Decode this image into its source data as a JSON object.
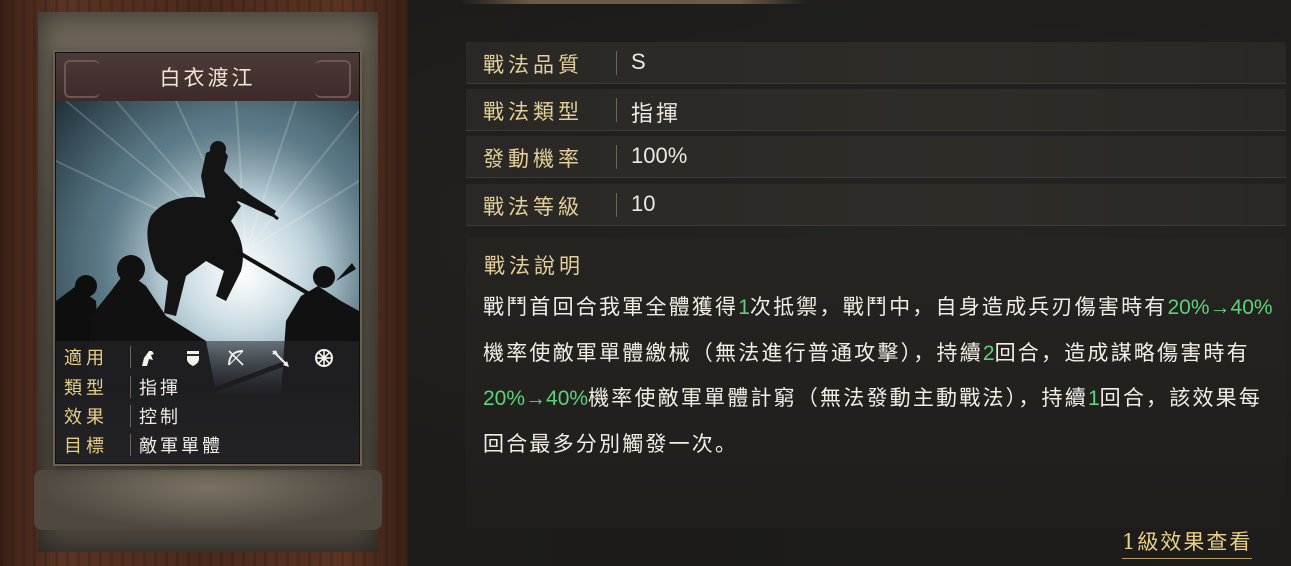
{
  "card": {
    "title": "白衣渡江",
    "stats": [
      {
        "key": "適用",
        "value": ""
      },
      {
        "key": "類型",
        "value": "指揮"
      },
      {
        "key": "效果",
        "value": "控制"
      },
      {
        "key": "目標",
        "value": "敵軍單體"
      }
    ],
    "troop_icons": [
      "cavalry-icon",
      "shield-icon",
      "bow-icon",
      "spear-icon",
      "chariot-wheel-icon"
    ]
  },
  "info": {
    "rows": [
      {
        "key": "戰法品質",
        "value": "S"
      },
      {
        "key": "戰法類型",
        "value": "指揮"
      },
      {
        "key": "發動機率",
        "value": "100%"
      },
      {
        "key": "戰法等級",
        "value": "10"
      }
    ],
    "desc_title": "戰法說明",
    "desc": [
      {
        "t": "戰鬥首回合我軍全體獲得",
        "h": false
      },
      {
        "t": "1",
        "h": true
      },
      {
        "t": "次抵禦，戰鬥中，自身造成兵刃傷害時有",
        "h": false
      },
      {
        "t": "20%→40%",
        "h": true
      },
      {
        "t": "機率使敵軍單體繳械（無法進行普通攻擊），持續",
        "h": false
      },
      {
        "t": "2",
        "h": true
      },
      {
        "t": "回合，造成謀略傷害時有",
        "h": false
      },
      {
        "t": "20%→40%",
        "h": true
      },
      {
        "t": "機率使敵軍單體計窮（無法發動主動戰法），持續",
        "h": false
      },
      {
        "t": "1",
        "h": true
      },
      {
        "t": "回合，該效果每回合最多分別觸發一次。",
        "h": false
      }
    ]
  },
  "link_label": "1級效果查看",
  "colors": {
    "gold": "#e4cf9a",
    "highlight": "#5cd27a",
    "text": "#f2eee6"
  }
}
